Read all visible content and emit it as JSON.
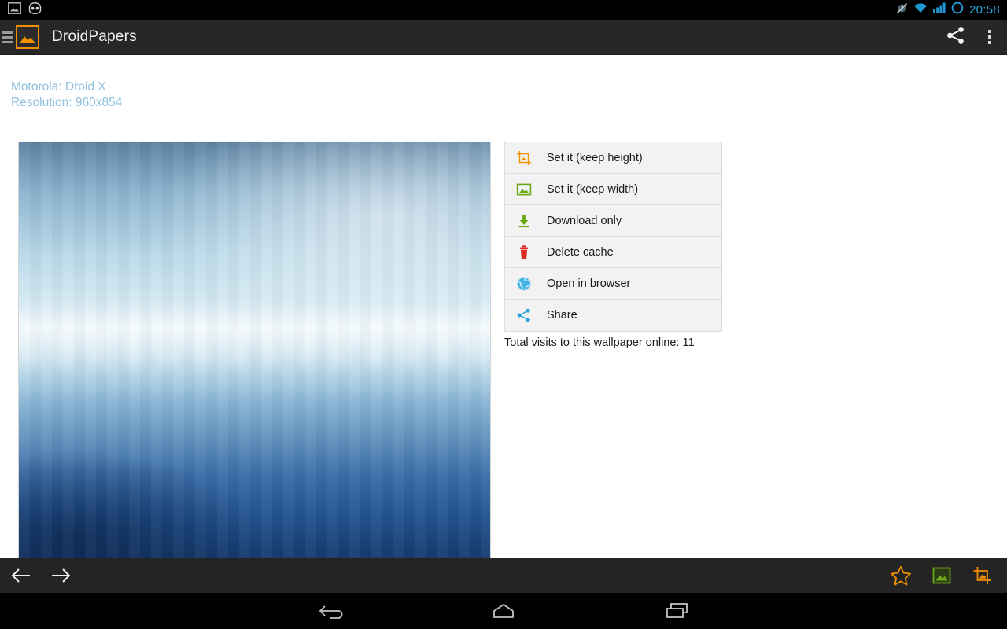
{
  "status_bar": {
    "icons": [
      "screenshot-notification-icon",
      "cyanogenmod-notification-icon"
    ],
    "right_icons": [
      "vibrate-off-icon",
      "wifi-icon",
      "cellular-signal-icon",
      "battery-icon"
    ],
    "time": "20:58",
    "accent_color": "#2aa3dd"
  },
  "action_bar": {
    "drawer_label": "drawer-indicator",
    "app_icon": "image-icon",
    "title": "DroidPapers",
    "share_label": "Share",
    "overflow_label": "More options",
    "background": "#272727"
  },
  "main": {
    "meta": {
      "device": "Motorola: Droid X",
      "resolution": "Resolution: 960x854",
      "color": "#8fc0dd"
    },
    "wallpaper_preview": "wallpaper-preview",
    "actions": [
      {
        "icon": "crop-icon",
        "icon_color": "#f39000",
        "label": "Set it (keep height)"
      },
      {
        "icon": "image-icon",
        "icon_color": "#6aa816",
        "label": "Set it (keep width)"
      },
      {
        "icon": "download-icon",
        "icon_color": "#6aa816",
        "label": "Download only"
      },
      {
        "icon": "trash-icon",
        "icon_color": "#d92b21",
        "label": "Delete cache"
      },
      {
        "icon": "globe-icon",
        "icon_color": "#2aa3dd",
        "label": "Open in browser"
      },
      {
        "icon": "share-icon",
        "icon_color": "#2aa3dd",
        "label": "Share"
      }
    ],
    "visits_text": "Total visits to this wallpaper online: 11"
  },
  "bottom_bar": {
    "prev_label": "Previous wallpaper",
    "next_label": "Next wallpaper",
    "favorite_label": "Add to favorites",
    "set_width_label": "Set it (keep width)",
    "set_height_label": "Set it (keep height)",
    "star_color": "#f39000",
    "image_color": "#6aa816",
    "crop_color": "#f39000"
  },
  "nav_bar": {
    "back_label": "Back",
    "home_label": "Home",
    "recents_label": "Recent apps"
  }
}
